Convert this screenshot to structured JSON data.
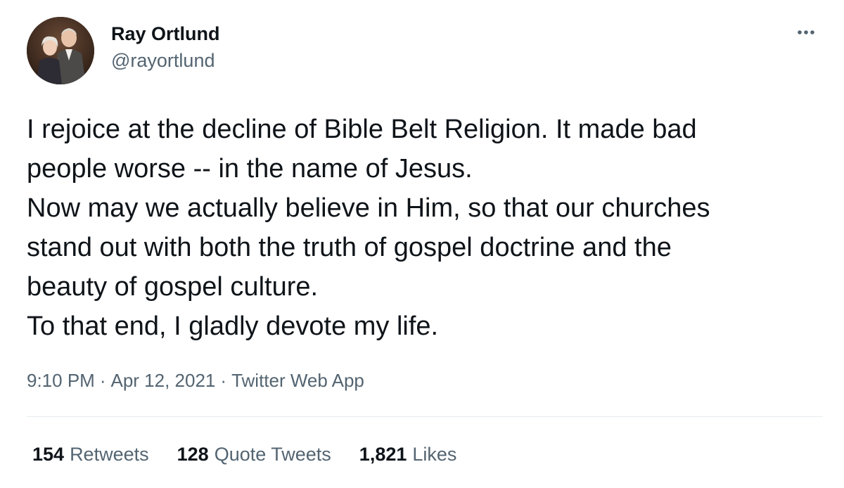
{
  "author": {
    "name": "Ray Ortlund",
    "handle": "@rayortlund",
    "avatar_icon": "profile-photo"
  },
  "more_icon": "more-options-icon",
  "tweet": {
    "text": "I rejoice at the decline of Bible Belt Religion. It made bad\npeople worse -- in the name of Jesus.\nNow may we actually believe in Him, so that our churches\nstand out with both the truth of gospel doctrine and the\nbeauty of gospel culture.\nTo that end, I gladly devote my life."
  },
  "meta": {
    "time": "9:10 PM",
    "separator": "·",
    "date": "Apr 12, 2021",
    "source": "Twitter Web App"
  },
  "stats": {
    "retweets_count": "154",
    "retweets_label": "Retweets",
    "quotes_count": "128",
    "quotes_label": "Quote Tweets",
    "likes_count": "1,821",
    "likes_label": "Likes"
  },
  "colors": {
    "text_primary": "#0f1419",
    "text_secondary": "#536471",
    "divider": "#e6ecf0"
  }
}
